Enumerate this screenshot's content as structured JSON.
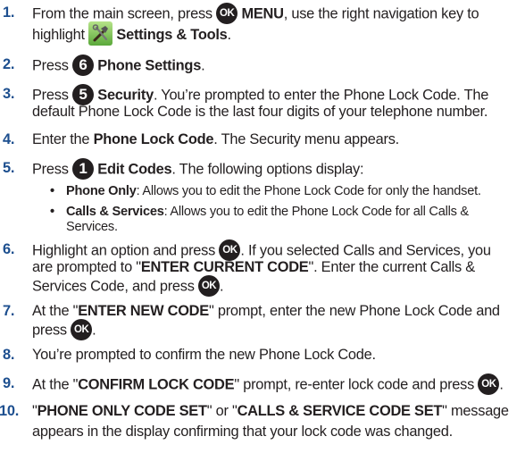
{
  "steps": [
    {
      "num": "1.",
      "l1a": "From the main screen, press ",
      "ok": "OK",
      "l1b": " MENU",
      "l1c": ", use the right navigation key to",
      "l2a": "highlight ",
      "l2b": " Settings & Tools",
      "l2c": "."
    },
    {
      "num": "2.",
      "a": "Press ",
      "digit": "6",
      "b": " Phone Settings",
      "c": "."
    },
    {
      "num": "3.",
      "a": "Press ",
      "digit": "5",
      "b": " Security",
      "c": ". You’re prompted to enter the Phone Lock Code. The",
      "l2": "default Phone Lock Code is the last four digits of your telephone number."
    },
    {
      "num": "4.",
      "a": "Enter the ",
      "b": "Phone Lock Code",
      "c": ". The Security menu appears."
    },
    {
      "num": "5.",
      "a": "Press ",
      "digit": "1",
      "b": " Edit Codes",
      "c": ". The following options display:"
    },
    {
      "num": "6.",
      "l1a": "Highlight an option and press ",
      "ok": "OK",
      "l1b": ". If you selected Calls and Services, you",
      "l2a": "are prompted to \"",
      "l2b": "ENTER CURRENT CODE",
      "l2c": "\". Enter the current Calls &",
      "l3a": "Services Code, and press ",
      "l3b": "."
    },
    {
      "num": "7.",
      "l1a": "At the \"",
      "l1b": "ENTER NEW CODE",
      "l1c": "\" prompt, enter the new Phone Lock Code and",
      "l2a": "press ",
      "l2b": "."
    },
    {
      "num": "8.",
      "a": "You’re prompted to confirm the new Phone Lock Code."
    },
    {
      "num": "9.",
      "a": "At the \"",
      "b": "CONFIRM LOCK CODE",
      "c": "\" prompt, re-enter lock code and press ",
      "d": "."
    },
    {
      "num": "10.",
      "l1a": "\"",
      "l1b": "PHONE ONLY CODE SET",
      "l1c": "\" or \"",
      "l1d": "CALLS & SERVICE CODE SET",
      "l1e": "\" message",
      "l2": "appears in the display confirming that your lock code was changed."
    }
  ],
  "options": [
    {
      "bullet": "•",
      "label": "Phone Only",
      "text": ": Allows you to edit the Phone Lock Code for only the handset."
    },
    {
      "bullet": "•",
      "label": "Calls & Services",
      "text": ": Allows you to edit the Phone Lock Code for all Calls &",
      "text2": "Services."
    }
  ],
  "icons": {
    "settings": "settings-tools-icon",
    "ok": "ok-key-icon"
  }
}
